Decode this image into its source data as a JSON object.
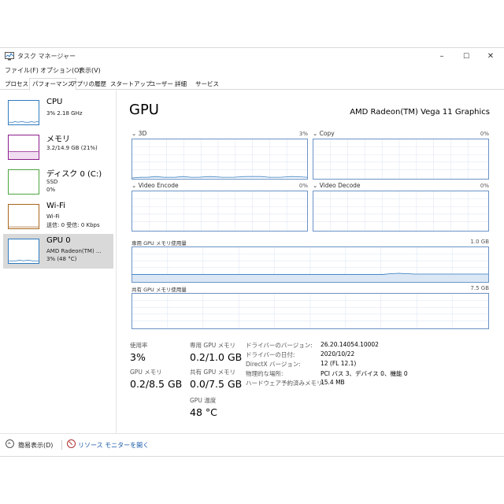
{
  "window": {
    "title": "タスク マネージャー",
    "minimize": "–",
    "maximize": "☐",
    "close": "✕"
  },
  "menu": [
    "ファイル(F)",
    "オプション(O)",
    "表示(V)"
  ],
  "tabs": [
    "プロセス",
    "パフォーマンス",
    "アプリの履歴",
    "スタートアップ",
    "ユーザー",
    "詳細",
    "サービス"
  ],
  "sidebar": {
    "items": [
      {
        "name": "CPU",
        "sub1": "3% 2.18 GHz",
        "sub2": "",
        "sub3": "",
        "color": "#2f7bbf"
      },
      {
        "name": "メモリ",
        "sub1": "3.2/14.9 GB (21%)",
        "sub2": "",
        "sub3": "",
        "color": "#8b1c8b"
      },
      {
        "name": "ディスク 0 (C:)",
        "sub1": "SSD",
        "sub2": "0%",
        "sub3": "",
        "color": "#4aa53c"
      },
      {
        "name": "Wi-Fi",
        "sub1": "Wi-Fi",
        "sub2": "送信: 0 受信: 0 Kbps",
        "sub3": "",
        "color": "#a7661c"
      },
      {
        "name": "GPU 0",
        "sub1": "AMD Radeon(TM) ...",
        "sub2": "3% (48 °C)",
        "sub3": "",
        "color": "#2f7bbf"
      }
    ]
  },
  "main": {
    "title": "GPU",
    "model": "AMD Radeon(TM) Vega 11 Graphics",
    "engines": [
      {
        "label": "3D",
        "pct": "3%"
      },
      {
        "label": "Copy",
        "pct": "0%"
      },
      {
        "label": "Video Encode",
        "pct": "0%"
      },
      {
        "label": "Video Decode",
        "pct": "0%"
      }
    ],
    "dedicated": {
      "label": "専用 GPU メモリ使用量",
      "max": "1.0 GB"
    },
    "shared": {
      "label": "共有 GPU メモリ使用量",
      "max": "7.5 GB"
    },
    "stats": {
      "usage_label": "使用率",
      "usage_value": "3%",
      "ded_label": "専用 GPU メモリ",
      "ded_value": "0.2/1.0 GB",
      "gpumem_label": "GPU メモリ",
      "gpumem_value": "0.2/8.5 GB",
      "shared_label": "共有 GPU メモリ",
      "shared_value": "0.0/7.5 GB",
      "temp_label": "GPU 温度",
      "temp_value": "48 °C"
    },
    "info": [
      {
        "label": "ドライバーのバージョン:",
        "value": "26.20.14054.10002"
      },
      {
        "label": "ドライバーの日付:",
        "value": "2020/10/22"
      },
      {
        "label": "DirectX バージョン:",
        "value": "12 (FL 12.1)"
      },
      {
        "label": "物理的な場所:",
        "value": "PCI バス 3、デバイス 0、機能 0"
      },
      {
        "label": "ハードウェア予約済みメモリ:",
        "value": "15.4 MB"
      }
    ]
  },
  "footer": {
    "fewer_details": "簡易表示(D)",
    "resource_monitor": "リソース モニターを開く"
  }
}
